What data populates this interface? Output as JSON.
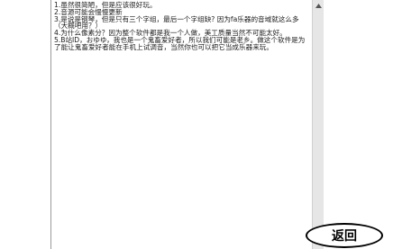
{
  "notes": {
    "lines": [
      "1.虽然很简陋，但是应该很好玩。",
      "2.音源可能会慢慢更新",
      "3.是说是钢琴，但是只有三个字组，最后一个字组缺? 因为fa乐器的音域就这么多（大概吧用？）",
      "4.为什么像素分？因为整个软件都是我一个人做，美工质量当然不可能太好。",
      "5.B站ID，おゆゆ，我也是一个鬼畜爱好者，所以我们可能是老乡。做这个软件是为了能让鬼畜爱好者能在手机上试调音，当然你也可以把它当成乐器来玩。"
    ]
  },
  "scrollbar": {
    "up_icon": "triangle-up-icon"
  },
  "actions": {
    "back_label": "返回"
  },
  "colors": {
    "text": "#1a1a1a",
    "scrollbar_track": "#e6e6e6",
    "border": "#000000"
  }
}
